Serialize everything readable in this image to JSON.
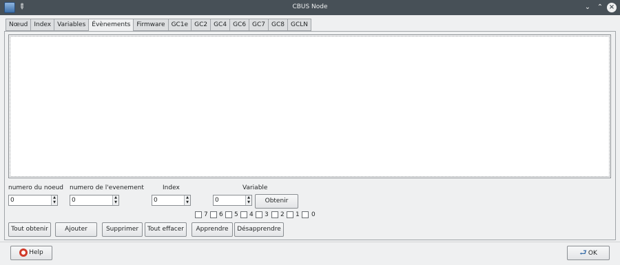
{
  "window": {
    "title": "CBUS Node"
  },
  "tabs": [
    {
      "label": "Nœud",
      "active": false
    },
    {
      "label": "Index",
      "active": false
    },
    {
      "label": "Variables",
      "active": false
    },
    {
      "label": "Évènements",
      "active": true
    },
    {
      "label": "Firmware",
      "active": false
    },
    {
      "label": "GC1e",
      "active": false
    },
    {
      "label": "GC2",
      "active": false
    },
    {
      "label": "GC4",
      "active": false
    },
    {
      "label": "GC6",
      "active": false
    },
    {
      "label": "GC7",
      "active": false
    },
    {
      "label": "GC8",
      "active": false
    },
    {
      "label": "GCLN",
      "active": false
    }
  ],
  "fields": {
    "node_number": {
      "label": "numero du noeud",
      "value": "0"
    },
    "event_number": {
      "label": "numero de l'evenement",
      "value": "0"
    },
    "index": {
      "label": "Index",
      "value": "0"
    },
    "variable": {
      "label": "Variable",
      "value": "0"
    }
  },
  "bits": [
    "7",
    "6",
    "5",
    "4",
    "3",
    "2",
    "1",
    "0"
  ],
  "buttons": {
    "obtenir": "Obtenir",
    "tout_obtenir": "Tout obtenir",
    "ajouter": "Ajouter",
    "supprimer": "Supprimer",
    "tout_effacer": "Tout effacer",
    "apprendre": "Apprendre",
    "desapprendre": "Désapprendre",
    "help": "Help",
    "ok": "OK"
  }
}
